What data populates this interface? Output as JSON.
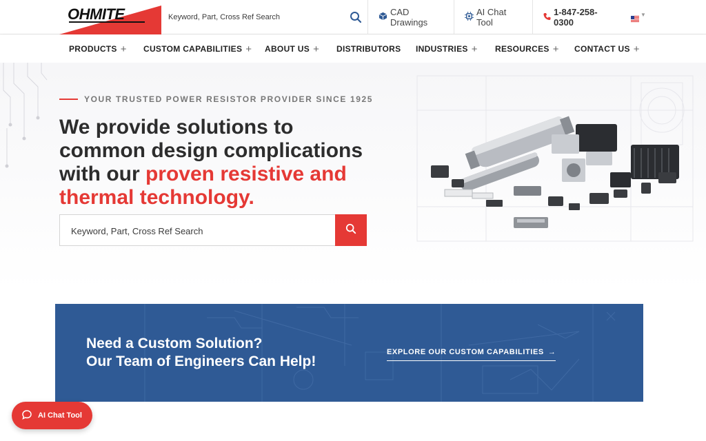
{
  "header": {
    "logo_text": "OHMITE",
    "search_placeholder": "Keyword, Part, Cross Ref Search",
    "cad_label": "CAD Drawings",
    "chat_label": "AI Chat Tool",
    "phone": "1-847-258-0300",
    "language_flag": "us-flag-icon"
  },
  "nav": {
    "items": [
      {
        "label": "PRODUCTS",
        "has_plus": true
      },
      {
        "label": "CUSTOM CAPABILITIES",
        "has_plus": true
      },
      {
        "label": "ABOUT US",
        "has_plus": true
      },
      {
        "label": "DISTRIBUTORS",
        "has_plus": false
      },
      {
        "label": "INDUSTRIES",
        "has_plus": true
      },
      {
        "label": "RESOURCES",
        "has_plus": true
      },
      {
        "label": "CONTACT US",
        "has_plus": true
      }
    ],
    "plus_symbol": "+"
  },
  "hero": {
    "tagline": "YOUR TRUSTED POWER RESISTOR PROVIDER SINCE 1925",
    "headline_part1": "We provide solutions to common design complications with our ",
    "headline_part2": "proven resistive and thermal technology.",
    "search_placeholder": "Keyword, Part, Cross Ref Search"
  },
  "banner": {
    "line1": "Need a Custom Solution?",
    "line2": "Our Team of Engineers Can Help!",
    "link_label": "EXPLORE OUR CUSTOM CAPABILITIES",
    "link_arrow": "→"
  },
  "floating_chat": {
    "label": "AI Chat Tool"
  },
  "colors": {
    "brand_red": "#e53935",
    "banner_blue": "#2f5a95",
    "text_dark": "#2d2d2d"
  }
}
